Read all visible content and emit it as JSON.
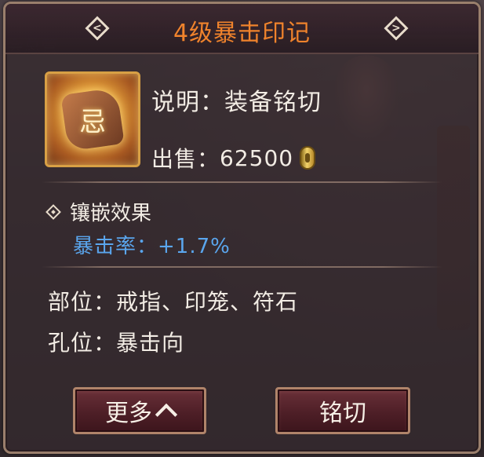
{
  "dialog": {
    "title": "4级暴击印记",
    "prev_icon": "chevron-left-diamond-icon",
    "next_icon": "chevron-right-diamond-icon"
  },
  "item": {
    "icon": "crit-seal-stone-icon",
    "description": "说明：装备铭切",
    "price_label": "出售：",
    "price_value": "62500",
    "currency_icon": "gold-coin-icon"
  },
  "inlay": {
    "heading": "镶嵌效果",
    "stat": "暴击率：+1.7%",
    "stat_color": "#5aa6ee"
  },
  "slots": {
    "position": "部位：戒指、印笼、符石",
    "hole": "孔位：暴击向"
  },
  "buttons": {
    "more": "更多",
    "inscribe": "铭切"
  },
  "colors": {
    "title": "#f0832c",
    "frame": "#9a7f6c",
    "button_bg": "#4e1f27"
  }
}
